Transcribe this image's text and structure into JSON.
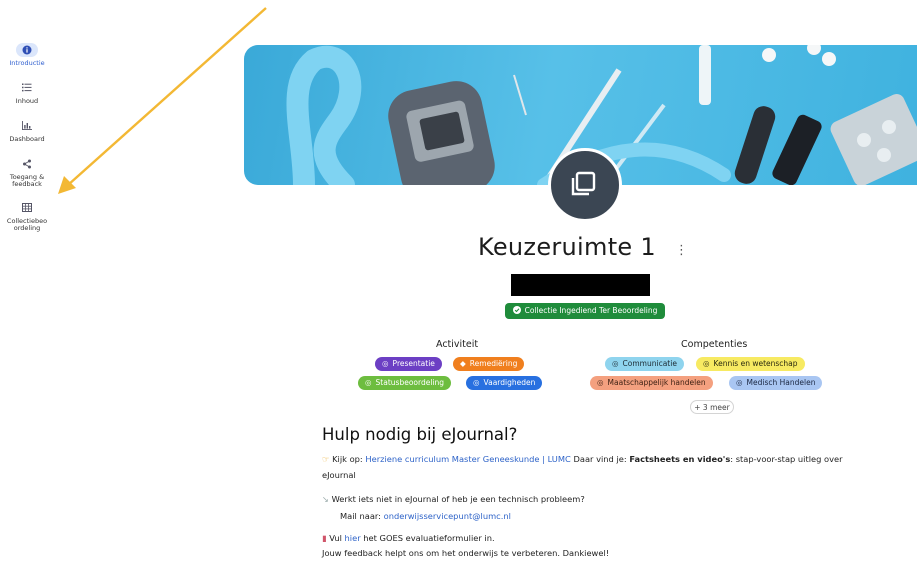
{
  "sidebar": {
    "items": [
      {
        "label": "Introductie",
        "icon": "info-icon"
      },
      {
        "label": "Inhoud",
        "icon": "list-icon"
      },
      {
        "label": "Dashboard",
        "icon": "chart-icon"
      },
      {
        "label": "Toegang &\nfeedback",
        "icon": "share-icon"
      },
      {
        "label": "Collectiebeo\nordeling",
        "icon": "grid-icon"
      }
    ],
    "active_index": 0
  },
  "banner": {
    "image": "diabetes-supplies-banner"
  },
  "header": {
    "title": "Keuzeruimte 1",
    "status": "Collectie Ingediend Ter Beoordeling"
  },
  "activiteit": {
    "heading": "Activiteit",
    "tags": [
      "Presentatie",
      "Remediëring",
      "Statusbeoordeling",
      "Vaardigheden"
    ]
  },
  "competenties": {
    "heading": "Competenties",
    "tags": [
      "Communicatie",
      "Kennis en wetenschap",
      "Maatschappelijk handelen",
      "Medisch Handelen"
    ],
    "more": "+ 3 meer"
  },
  "help": {
    "title": "Hulp nodig bij eJournal?",
    "line1_prefix": "Kijk op: ",
    "line1_link": "Herziene curriculum Master Geneeskunde | LUMC",
    "line1_mid": " Daar vind je: ",
    "line1_bold": "Factsheets en video's",
    "line1_rest": ": stap-voor-stap uitleg over",
    "line1_cont": "eJournal",
    "line2": "Werkt iets niet in eJournal of heb je een technisch probleem?",
    "line3_prefix": "Mail naar: ",
    "line3_link": "onderwijsservicepunt@lumc.nl",
    "line4_prefix": "Vul ",
    "line4_link": "hier",
    "line4_rest": " het GOES evaluatieformulier in.",
    "line5": "Jouw feedback helpt ons om het onderwijs te verbeteren. Dankiewel!"
  },
  "colors": {
    "accent": "#2f5fcf",
    "status_green": "#1f8c3b",
    "arrow": "#f3b834",
    "tag_presentatie": "#6c3fc4",
    "tag_remediering": "#f07f1e",
    "tag_statusbeoordeling": "#6dbd3f",
    "tag_vaardigheden": "#2870e0",
    "tag_communicatie": "#8fd4ee",
    "tag_kennis": "#f7ea62",
    "tag_maatschappelijk": "#f4a07f",
    "tag_medisch": "#a9c6f2"
  }
}
